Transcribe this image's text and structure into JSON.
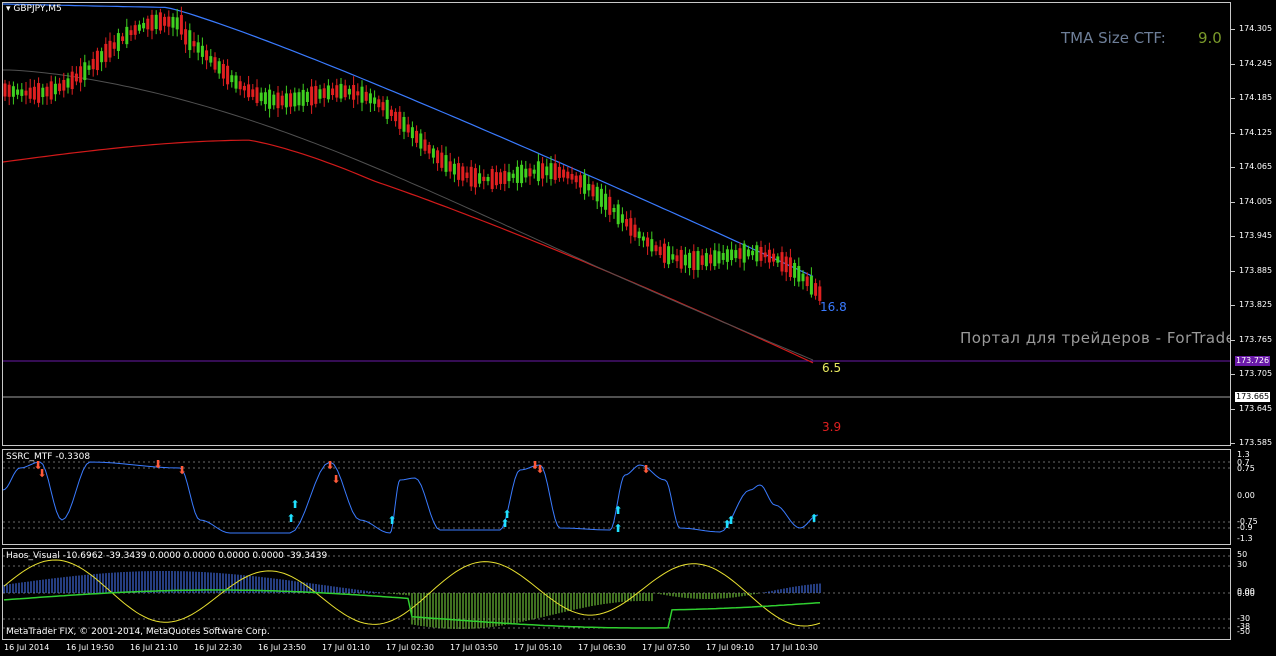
{
  "main": {
    "symbol_title": "GBPJPY,M5",
    "tma_label": "TMA Size CTF:",
    "tma_value": "9.0",
    "watermark": "Портал для трейдеров - ForTrader.ru",
    "band_labels": {
      "upper": "16.8",
      "middle": "6.5",
      "lower": "3.9"
    },
    "price_axis": [
      "174.305",
      "174.245",
      "174.185",
      "174.125",
      "174.065",
      "174.005",
      "173.945",
      "173.885",
      "173.825",
      "173.765",
      "173.705",
      "173.645",
      "173.585"
    ],
    "purple_tag": "173.726",
    "bid_tag": "173.665",
    "colors": {
      "upper_band": "#3a7bff",
      "lower_band": "#d21a1a",
      "mid_line": "#505050",
      "bull": "#40d020",
      "bear": "#e02020",
      "purple_line": "#6a1aa8"
    }
  },
  "ssrc": {
    "title": "SSRC_MTF -0.3308",
    "axis": [
      "1.3",
      "0.7",
      "0.75",
      "0.00",
      "-0.75",
      "-0.9",
      "-1.3"
    ]
  },
  "haos": {
    "title": "Haos_Visual -10.6962 -39.3439 0.0000 0.0000 0.0000 0.0000 -39.3439",
    "axis": [
      "50",
      "30",
      "0.00",
      "0.00",
      "-30",
      "-38",
      "-50"
    ],
    "copyright": "MetaTrader FIX, © 2001-2014, MetaQuotes Software Corp."
  },
  "time_axis": [
    "16 Jul 2014",
    "16 Jul 19:50",
    "16 Jul 21:10",
    "16 Jul 22:30",
    "16 Jul 23:50",
    "17 Jul 01:10",
    "17 Jul 02:30",
    "17 Jul 03:50",
    "17 Jul 05:10",
    "17 Jul 06:30",
    "17 Jul 07:50",
    "17 Jul 09:10",
    "17 Jul 10:30"
  ]
}
